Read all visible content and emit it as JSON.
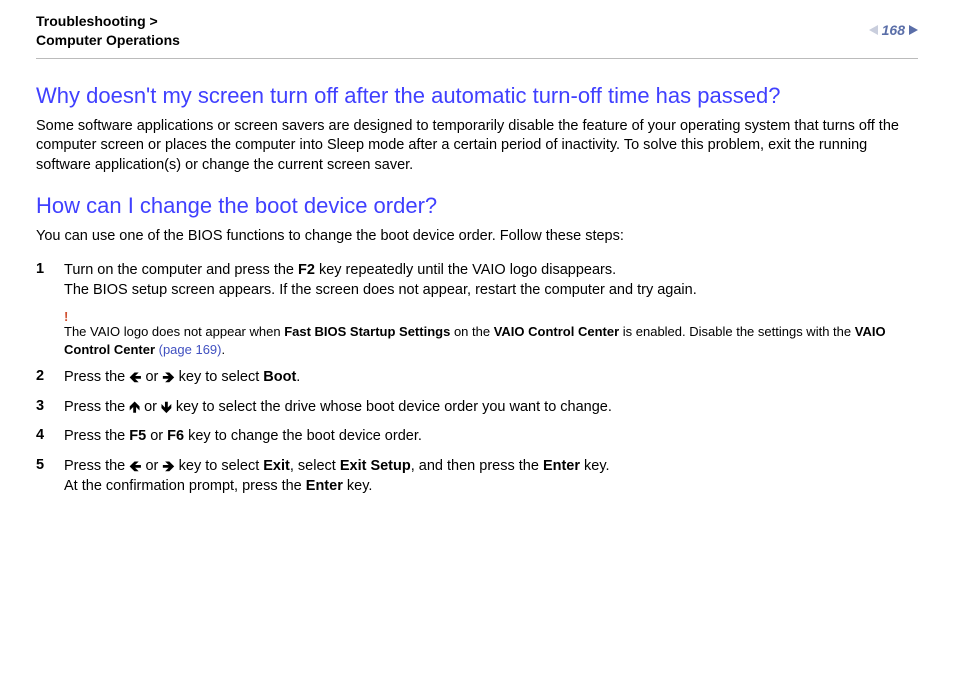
{
  "breadcrumb": {
    "line1": "Troubleshooting >",
    "line2": "Computer Operations"
  },
  "pageNumber": "168",
  "q1": {
    "title": "Why doesn't my screen turn off after the automatic turn-off time has passed?",
    "body": "Some software applications or screen savers are designed to temporarily disable the feature of your operating system that turns off the computer screen or places the computer into Sleep mode after a certain period of inactivity. To solve this problem, exit the running software application(s) or change the current screen saver."
  },
  "q2": {
    "title": "How can I change the boot device order?",
    "intro": "You can use one of the BIOS functions to change the boot device order. Follow these steps:",
    "steps": {
      "s1": {
        "num": "1",
        "a": "Turn on the computer and press the ",
        "key": "F2",
        "b": " key repeatedly until the VAIO logo disappears.",
        "line2": "The BIOS setup screen appears. If the screen does not appear, restart the computer and try again."
      },
      "note": {
        "a": "The VAIO logo does not appear when ",
        "b1": "Fast BIOS Startup Settings",
        "c": " on the ",
        "b2": "VAIO Control Center",
        "d": " is enabled. Disable the settings with the ",
        "b3": "VAIO Control Center",
        "link": " (page 169)",
        "e": "."
      },
      "s2": {
        "num": "2",
        "a": "Press the ",
        "or": " or ",
        "b": " key to select ",
        "target": "Boot",
        "c": "."
      },
      "s3": {
        "num": "3",
        "a": "Press the ",
        "or": " or ",
        "b": " key to select the drive whose boot device order you want to change."
      },
      "s4": {
        "num": "4",
        "a": "Press the ",
        "k1": "F5",
        "or": " or ",
        "k2": "F6",
        "b": " key to change the boot device order."
      },
      "s5": {
        "num": "5",
        "a": "Press the ",
        "or": " or ",
        "b": " key to select ",
        "exit": "Exit",
        "c": ", select ",
        "exitSetup": "Exit Setup",
        "d": ", and then press the ",
        "enter": "Enter",
        "e": " key.",
        "line2a": "At the confirmation prompt, press the ",
        "line2b": " key."
      }
    }
  },
  "arrows": {
    "left": "🡸",
    "right": "🡺",
    "up": "🡹",
    "down": "🡻"
  }
}
